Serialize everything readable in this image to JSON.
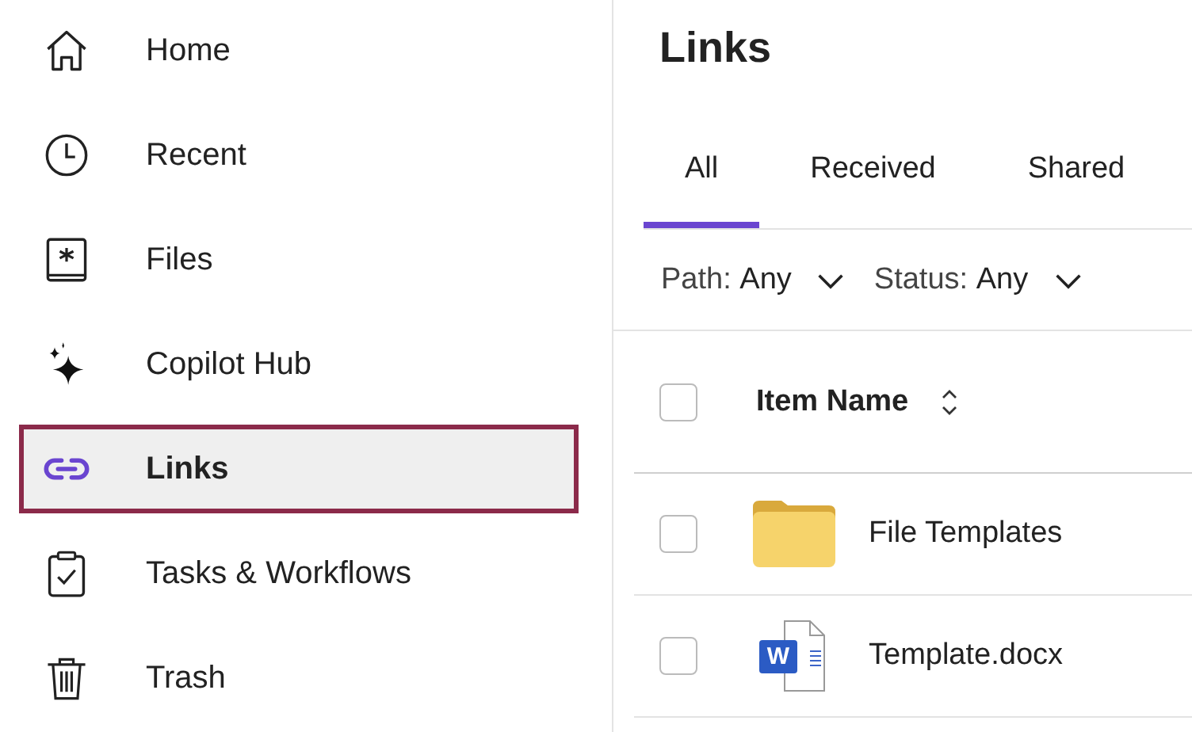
{
  "sidebar": {
    "items": [
      {
        "label": "Home",
        "kind": "home",
        "selected": false
      },
      {
        "label": "Recent",
        "kind": "clock",
        "selected": false
      },
      {
        "label": "Files",
        "kind": "book",
        "selected": false
      },
      {
        "label": "Copilot Hub",
        "kind": "sparkle",
        "selected": false
      },
      {
        "label": "Links",
        "kind": "link",
        "selected": true
      },
      {
        "label": "Tasks & Workflows",
        "kind": "clipboard",
        "selected": false
      },
      {
        "label": "Trash",
        "kind": "trash",
        "selected": false
      }
    ]
  },
  "title": "Links",
  "tabs": [
    {
      "label": "All",
      "selected": true
    },
    {
      "label": "Received",
      "selected": false
    },
    {
      "label": "Shared",
      "selected": false
    }
  ],
  "filters": [
    {
      "label": "Path:",
      "value": "Any"
    },
    {
      "label": "Status:",
      "value": "Any"
    }
  ],
  "table": {
    "header": {
      "label": "Item Name",
      "checked": false
    },
    "rows": [
      {
        "kind": "folder",
        "name": "File Templates",
        "checked": false
      },
      {
        "kind": "document",
        "name": "Template.docx",
        "badge": "W",
        "checked": false
      }
    ]
  }
}
